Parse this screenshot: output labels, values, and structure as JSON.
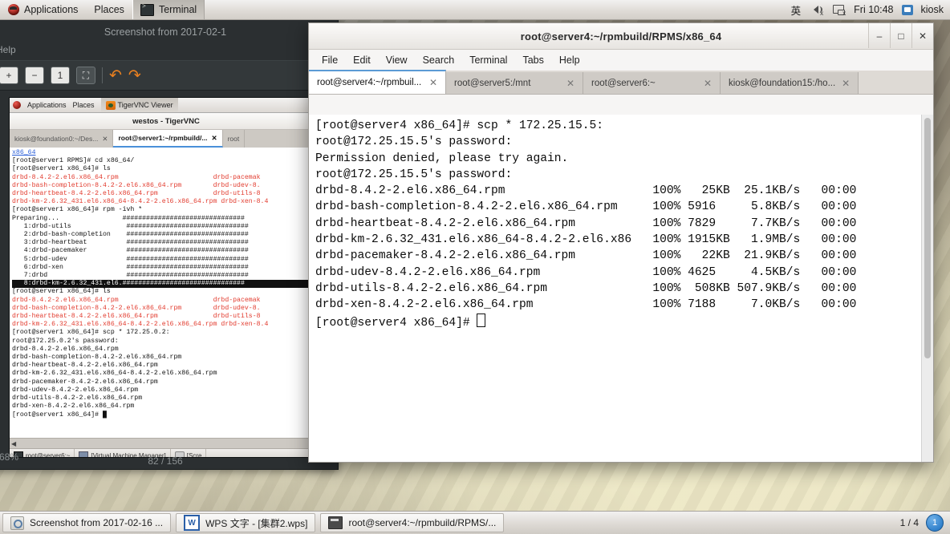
{
  "top_panel": {
    "applications": "Applications",
    "places": "Places",
    "active_window": "Terminal",
    "tray": {
      "input_method": "英",
      "clock": "Fri 10:48",
      "user": "kiosk",
      "volume_icon": "volume-muted-icon",
      "network_icon": "network-disconnected-icon",
      "user_icon": "user-icon"
    }
  },
  "screenshot_window": {
    "title": "Screenshot from 2017-02-1",
    "menu_help": "Help",
    "toolbar": {
      "zoom_in": "+",
      "zoom_out": "−",
      "zoom_one": "1",
      "fit": "⛶",
      "rotate_left": "↶",
      "rotate_right": "↷"
    },
    "zoom_level": "68%",
    "image_counter": "82 / 156",
    "inner": {
      "panel": {
        "applications": "Applications",
        "places": "Places",
        "active_window": "TigerVNC Viewer"
      },
      "titlebar": "westos - TigerVNC",
      "tabs": [
        {
          "label": "kiosk@foundation0:~/Des...",
          "active": false
        },
        {
          "label": "root@server1:~/rpmbuild/...",
          "active": true
        },
        {
          "label": "root",
          "active": false
        }
      ],
      "terminal_lines": [
        {
          "text": "x86_64",
          "style": "blue"
        },
        {
          "text": "[root@server1 RPMS]# cd x86_64/",
          "style": "plain"
        },
        {
          "text": "[root@server1 x86_64]# ls",
          "style": "plain"
        },
        {
          "text": "drbd-8.4.2-2.el6.x86_64.rpm                        drbd-pacemak",
          "style": "red"
        },
        {
          "text": "drbd-bash-completion-8.4.2-2.el6.x86_64.rpm        drbd-udev-8.",
          "style": "red"
        },
        {
          "text": "drbd-heartbeat-8.4.2-2.el6.x86_64.rpm              drbd-utils-8",
          "style": "red"
        },
        {
          "text": "drbd-km-2.6.32_431.el6.x86_64-8.4.2-2.el6.x86_64.rpm drbd-xen-8.4",
          "style": "red"
        },
        {
          "text": "[root@server1 x86_64]# rpm -ivh *",
          "style": "plain"
        },
        {
          "text": "Preparing...                ###############################",
          "style": "plain"
        },
        {
          "text": "   1:drbd-utils              ###############################",
          "style": "plain"
        },
        {
          "text": "   2:drbd-bash-completion    ###############################",
          "style": "plain"
        },
        {
          "text": "   3:drbd-heartbeat          ###############################",
          "style": "plain"
        },
        {
          "text": "   4:drbd-pacemaker          ###############################",
          "style": "plain"
        },
        {
          "text": "   5:drbd-udev               ###############################",
          "style": "plain"
        },
        {
          "text": "   6:drbd-xen                ###############################",
          "style": "plain"
        },
        {
          "text": "   7:drbd                    ###############################",
          "style": "plain"
        },
        {
          "text": "   8:drbd-km-2.6.32_431.el6.###############################",
          "style": "inverse"
        },
        {
          "text": "[root@server1 x86_64]# ls",
          "style": "plain"
        },
        {
          "text": "drbd-8.4.2-2.el6.x86_64.rpm                        drbd-pacemak",
          "style": "red"
        },
        {
          "text": "drbd-bash-completion-8.4.2-2.el6.x86_64.rpm        drbd-udev-8.",
          "style": "red"
        },
        {
          "text": "drbd-heartbeat-8.4.2-2.el6.x86_64.rpm              drbd-utils-8",
          "style": "red"
        },
        {
          "text": "drbd-km-2.6.32_431.el6.x86_64-8.4.2-2.el6.x86_64.rpm drbd-xen-8.4",
          "style": "red"
        },
        {
          "text": "[root@server1 x86_64]# scp * 172.25.0.2:",
          "style": "plain"
        },
        {
          "text": "root@172.25.0.2's password:",
          "style": "plain"
        },
        {
          "text": "drbd-8.4.2-2.el6.x86_64.rpm",
          "style": "plain"
        },
        {
          "text": "drbd-bash-completion-8.4.2-2.el6.x86_64.rpm",
          "style": "plain"
        },
        {
          "text": "drbd-heartbeat-8.4.2-2.el6.x86_64.rpm",
          "style": "plain"
        },
        {
          "text": "drbd-km-2.6.32_431.el6.x86_64-8.4.2-2.el6.x86_64.rpm",
          "style": "plain"
        },
        {
          "text": "drbd-pacemaker-8.4.2-2.el6.x86_64.rpm",
          "style": "plain"
        },
        {
          "text": "drbd-udev-8.4.2-2.el6.x86_64.rpm",
          "style": "plain"
        },
        {
          "text": "drbd-utils-8.4.2-2.el6.x86_64.rpm",
          "style": "plain"
        },
        {
          "text": "drbd-xen-8.4.2-2.el6.x86_64.rpm",
          "style": "plain"
        },
        {
          "text": "[root@server1 x86_64]# █",
          "style": "plain"
        }
      ],
      "taskbar": [
        {
          "label": "root@server6:~",
          "icon": "terminal-icon"
        },
        {
          "label": "[Virtual Machine Manager]",
          "icon": "vm-icon"
        },
        {
          "label": "[Scre",
          "icon": "screenshot-icon"
        }
      ]
    }
  },
  "terminal_window": {
    "title": "root@server4:~/rpmbuild/RPMS/x86_64",
    "window_buttons": {
      "minimize": "–",
      "maximize": "□",
      "close": "✕"
    },
    "menus": [
      "File",
      "Edit",
      "View",
      "Search",
      "Terminal",
      "Tabs",
      "Help"
    ],
    "tabs": [
      {
        "label": "root@server4:~/rpmbuil...",
        "close": "✕",
        "active": true
      },
      {
        "label": "root@server5:/mnt",
        "close": "✕",
        "active": false
      },
      {
        "label": "root@server6:~",
        "close": "✕",
        "active": false
      },
      {
        "label": "kiosk@foundation15:/ho...",
        "close": "✕",
        "active": false
      }
    ],
    "lines": [
      "[root@server4 x86_64]# scp * 172.25.15.5:",
      "root@172.25.15.5's password:",
      "Permission denied, please try again.",
      "root@172.25.15.5's password:",
      "drbd-8.4.2-2.el6.x86_64.rpm                     100%   25KB  25.1KB/s   00:00",
      "drbd-bash-completion-8.4.2-2.el6.x86_64.rpm     100% 5916     5.8KB/s   00:00",
      "drbd-heartbeat-8.4.2-2.el6.x86_64.rpm           100% 7829     7.7KB/s   00:00",
      "drbd-km-2.6.32_431.el6.x86_64-8.4.2-2.el6.x86   100% 1915KB   1.9MB/s   00:00",
      "drbd-pacemaker-8.4.2-2.el6.x86_64.rpm           100%   22KB  21.9KB/s   00:00",
      "drbd-udev-8.4.2-2.el6.x86_64.rpm                100% 4625     4.5KB/s   00:00",
      "drbd-utils-8.4.2-2.el6.x86_64.rpm               100%  508KB 507.9KB/s   00:00",
      "drbd-xen-8.4.2-2.el6.x86_64.rpm                 100% 7188     7.0KB/s   00:00"
    ],
    "prompt": "[root@server4 x86_64]# "
  },
  "bottom_panel": {
    "tasks": [
      {
        "label": "Screenshot from 2017-02-16 ...",
        "icon": "screenshot-icon"
      },
      {
        "label": "WPS 文字 - [集群2.wps]",
        "icon": "wps-icon"
      },
      {
        "label": "root@server4:~/rpmbuild/RPMS/...",
        "icon": "terminal-icon"
      }
    ],
    "workspace_label": "1 / 4",
    "workspace_badge": "1"
  },
  "colors": {
    "accent_tab": "#5b9bd5",
    "terminal_red": "#e23b2e",
    "terminal_blue": "#2b5fd9",
    "panel_bg": "#dedad5"
  }
}
